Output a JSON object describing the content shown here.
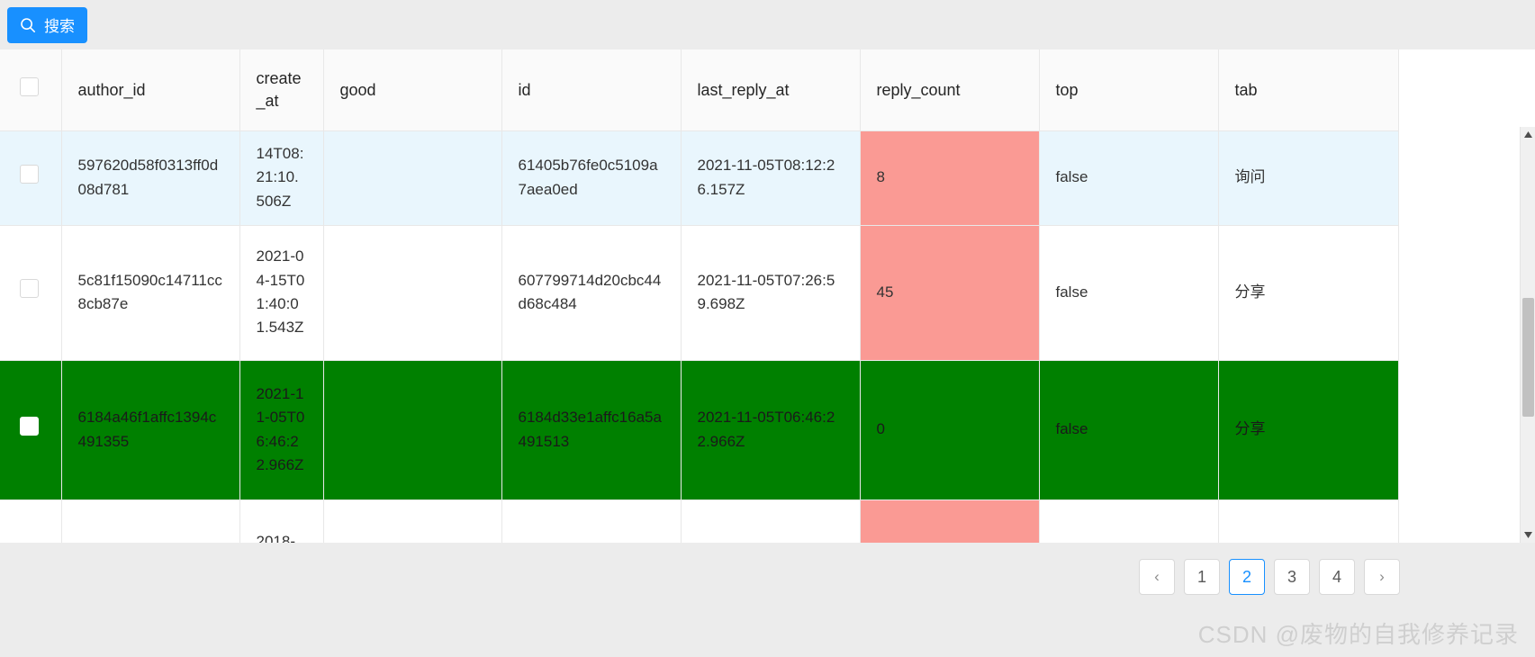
{
  "toolbar": {
    "search_label": "搜索",
    "search_icon": "search-icon",
    "accent_color": "#1890ff"
  },
  "table": {
    "columns": [
      {
        "key": "checkbox",
        "label": ""
      },
      {
        "key": "author_id",
        "label": "author_id"
      },
      {
        "key": "create_at",
        "label": "create_at"
      },
      {
        "key": "good",
        "label": "good"
      },
      {
        "key": "id",
        "label": "id"
      },
      {
        "key": "last_reply_at",
        "label": "last_reply_at"
      },
      {
        "key": "reply_count",
        "label": "reply_count"
      },
      {
        "key": "top",
        "label": "top"
      },
      {
        "key": "tab",
        "label": "tab"
      }
    ],
    "rows": [
      {
        "author_id": "597620d58f0313ff0d08d781",
        "create_at": "14T08:21:10.506Z",
        "good": "",
        "id": "61405b76fe0c5109a7aea0ed",
        "last_reply_at": "2021-11-05T08:12:26.157Z",
        "reply_count": "8",
        "top": "false",
        "tab": "询问",
        "state": "highlight",
        "reply_count_flagged": true,
        "checked": false
      },
      {
        "author_id": "5c81f15090c14711cc8cb87e",
        "create_at": "2021-04-15T01:40:01.543Z",
        "good": "",
        "id": "607799714d20cbc44d68c484",
        "last_reply_at": "2021-11-05T07:26:59.698Z",
        "reply_count": "45",
        "top": "false",
        "tab": "分享",
        "state": "normal",
        "reply_count_flagged": true,
        "checked": false
      },
      {
        "author_id": "6184a46f1affc1394c491355",
        "create_at": "2021-11-05T06:46:22.966Z",
        "good": "",
        "id": "6184d33e1affc16a5a491513",
        "last_reply_at": "2021-11-05T06:46:22.966Z",
        "reply_count": "0",
        "top": "false",
        "tab": "分享",
        "state": "selected",
        "reply_count_flagged": true,
        "checked": true
      },
      {
        "author_id": "",
        "create_at": "2018-",
        "good": "",
        "id": "",
        "last_reply_at": "",
        "reply_count": "",
        "top": "",
        "tab": "",
        "state": "normal",
        "reply_count_flagged": true,
        "checked": false
      }
    ],
    "colors": {
      "selected_row": "#008000",
      "highlight_row": "#e9f6fd",
      "flagged_cell": "#fa9a94",
      "header_bg": "#fafafa",
      "border": "#e8e8e8"
    }
  },
  "pagination": {
    "prev_label": "‹",
    "next_label": "›",
    "pages": [
      "1",
      "2",
      "3",
      "4"
    ],
    "current": "2"
  },
  "watermark": {
    "text": "CSDN @废物的自我修养记录"
  },
  "scrollbar": {
    "up_arrow": "▲",
    "down_arrow": "▼"
  }
}
